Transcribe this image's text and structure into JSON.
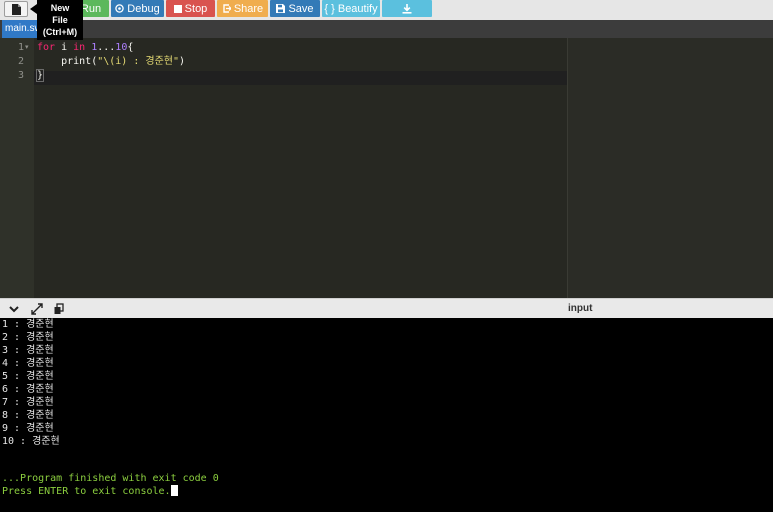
{
  "toolbar": {
    "tooltip": [
      "New",
      "File",
      "(Ctrl+M)"
    ],
    "run_label": "Run",
    "debug_label": "Debug",
    "stop_label": "Stop",
    "share_label": "Share",
    "save_label": "Save",
    "beautify_label": "{ } Beautify",
    "colors": {
      "run": "#5cb85c",
      "debug": "#337ab7",
      "stop": "#d9534f",
      "share": "#f0ad4e",
      "save": "#337ab7",
      "beautify": "#5bc0de"
    }
  },
  "tab": {
    "filename": "main.swift"
  },
  "editor": {
    "line_numbers": [
      "1",
      "2",
      "3"
    ],
    "lines": [
      {
        "kw1": "for",
        "var": " i ",
        "kw2": "in",
        "sp": " ",
        "range_start": "1",
        "range_op": "...",
        "range_end": "10",
        "open": "{"
      },
      {
        "indent": "    ",
        "fn": "print(",
        "str": "\"\\(i) : 경준현\"",
        "close": ")"
      },
      {
        "brace": "}"
      }
    ]
  },
  "splitter": {
    "input_label": "input"
  },
  "console": {
    "output": [
      "1 : 경준현",
      "2 : 경준현",
      "3 : 경준현",
      "4 : 경준현",
      "5 : 경준현",
      "6 : 경준현",
      "7 : 경준현",
      "8 : 경준현",
      "9 : 경준현",
      "10 : 경준현"
    ],
    "finished": "...Program finished with exit code 0",
    "prompt": "Press ENTER to exit console."
  }
}
